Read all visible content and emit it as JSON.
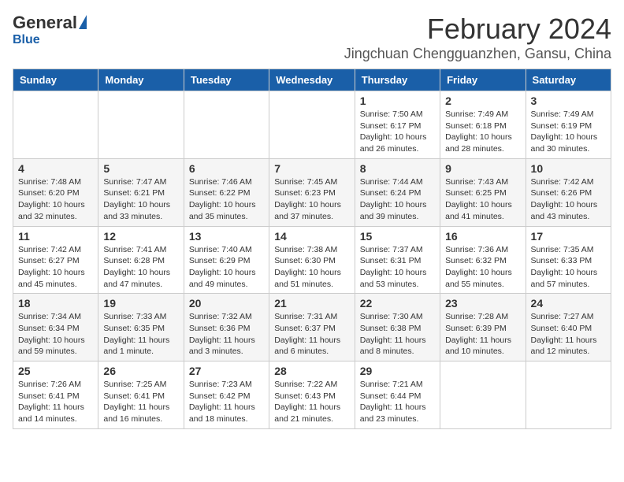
{
  "logo": {
    "general": "General",
    "blue": "Blue"
  },
  "title": "February 2024",
  "subtitle": "Jingchuan Chengguanzhen, Gansu, China",
  "weekdays": [
    "Sunday",
    "Monday",
    "Tuesday",
    "Wednesday",
    "Thursday",
    "Friday",
    "Saturday"
  ],
  "weeks": [
    [
      {
        "day": "",
        "info": ""
      },
      {
        "day": "",
        "info": ""
      },
      {
        "day": "",
        "info": ""
      },
      {
        "day": "",
        "info": ""
      },
      {
        "day": "1",
        "info": "Sunrise: 7:50 AM\nSunset: 6:17 PM\nDaylight: 10 hours and 26 minutes."
      },
      {
        "day": "2",
        "info": "Sunrise: 7:49 AM\nSunset: 6:18 PM\nDaylight: 10 hours and 28 minutes."
      },
      {
        "day": "3",
        "info": "Sunrise: 7:49 AM\nSunset: 6:19 PM\nDaylight: 10 hours and 30 minutes."
      }
    ],
    [
      {
        "day": "4",
        "info": "Sunrise: 7:48 AM\nSunset: 6:20 PM\nDaylight: 10 hours and 32 minutes."
      },
      {
        "day": "5",
        "info": "Sunrise: 7:47 AM\nSunset: 6:21 PM\nDaylight: 10 hours and 33 minutes."
      },
      {
        "day": "6",
        "info": "Sunrise: 7:46 AM\nSunset: 6:22 PM\nDaylight: 10 hours and 35 minutes."
      },
      {
        "day": "7",
        "info": "Sunrise: 7:45 AM\nSunset: 6:23 PM\nDaylight: 10 hours and 37 minutes."
      },
      {
        "day": "8",
        "info": "Sunrise: 7:44 AM\nSunset: 6:24 PM\nDaylight: 10 hours and 39 minutes."
      },
      {
        "day": "9",
        "info": "Sunrise: 7:43 AM\nSunset: 6:25 PM\nDaylight: 10 hours and 41 minutes."
      },
      {
        "day": "10",
        "info": "Sunrise: 7:42 AM\nSunset: 6:26 PM\nDaylight: 10 hours and 43 minutes."
      }
    ],
    [
      {
        "day": "11",
        "info": "Sunrise: 7:42 AM\nSunset: 6:27 PM\nDaylight: 10 hours and 45 minutes."
      },
      {
        "day": "12",
        "info": "Sunrise: 7:41 AM\nSunset: 6:28 PM\nDaylight: 10 hours and 47 minutes."
      },
      {
        "day": "13",
        "info": "Sunrise: 7:40 AM\nSunset: 6:29 PM\nDaylight: 10 hours and 49 minutes."
      },
      {
        "day": "14",
        "info": "Sunrise: 7:38 AM\nSunset: 6:30 PM\nDaylight: 10 hours and 51 minutes."
      },
      {
        "day": "15",
        "info": "Sunrise: 7:37 AM\nSunset: 6:31 PM\nDaylight: 10 hours and 53 minutes."
      },
      {
        "day": "16",
        "info": "Sunrise: 7:36 AM\nSunset: 6:32 PM\nDaylight: 10 hours and 55 minutes."
      },
      {
        "day": "17",
        "info": "Sunrise: 7:35 AM\nSunset: 6:33 PM\nDaylight: 10 hours and 57 minutes."
      }
    ],
    [
      {
        "day": "18",
        "info": "Sunrise: 7:34 AM\nSunset: 6:34 PM\nDaylight: 10 hours and 59 minutes."
      },
      {
        "day": "19",
        "info": "Sunrise: 7:33 AM\nSunset: 6:35 PM\nDaylight: 11 hours and 1 minute."
      },
      {
        "day": "20",
        "info": "Sunrise: 7:32 AM\nSunset: 6:36 PM\nDaylight: 11 hours and 3 minutes."
      },
      {
        "day": "21",
        "info": "Sunrise: 7:31 AM\nSunset: 6:37 PM\nDaylight: 11 hours and 6 minutes."
      },
      {
        "day": "22",
        "info": "Sunrise: 7:30 AM\nSunset: 6:38 PM\nDaylight: 11 hours and 8 minutes."
      },
      {
        "day": "23",
        "info": "Sunrise: 7:28 AM\nSunset: 6:39 PM\nDaylight: 11 hours and 10 minutes."
      },
      {
        "day": "24",
        "info": "Sunrise: 7:27 AM\nSunset: 6:40 PM\nDaylight: 11 hours and 12 minutes."
      }
    ],
    [
      {
        "day": "25",
        "info": "Sunrise: 7:26 AM\nSunset: 6:41 PM\nDaylight: 11 hours and 14 minutes."
      },
      {
        "day": "26",
        "info": "Sunrise: 7:25 AM\nSunset: 6:41 PM\nDaylight: 11 hours and 16 minutes."
      },
      {
        "day": "27",
        "info": "Sunrise: 7:23 AM\nSunset: 6:42 PM\nDaylight: 11 hours and 18 minutes."
      },
      {
        "day": "28",
        "info": "Sunrise: 7:22 AM\nSunset: 6:43 PM\nDaylight: 11 hours and 21 minutes."
      },
      {
        "day": "29",
        "info": "Sunrise: 7:21 AM\nSunset: 6:44 PM\nDaylight: 11 hours and 23 minutes."
      },
      {
        "day": "",
        "info": ""
      },
      {
        "day": "",
        "info": ""
      }
    ]
  ]
}
